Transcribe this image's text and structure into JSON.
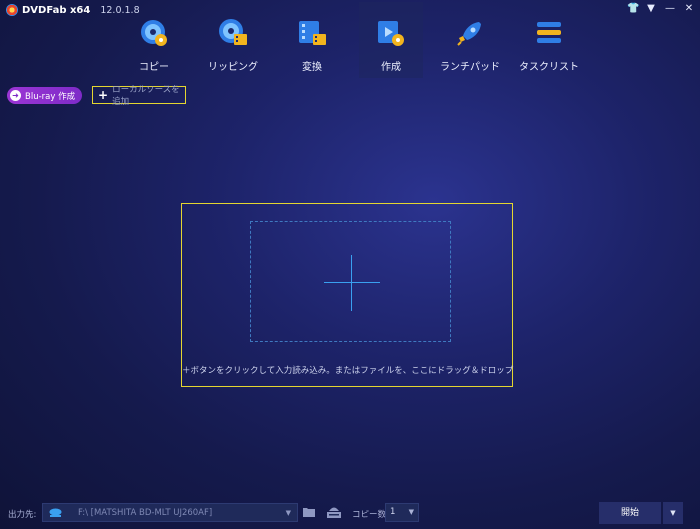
{
  "app": {
    "brand": "DVDFab x64",
    "version": "12.0.1.8"
  },
  "window_controls": [
    "shirt-icon",
    "dropdown-icon",
    "minimize-icon",
    "close-icon"
  ],
  "nav": {
    "tabs": [
      {
        "label": "コピー",
        "icon": "disc-copy-icon"
      },
      {
        "label": "リッピング",
        "icon": "disc-rip-icon"
      },
      {
        "label": "変換",
        "icon": "film-convert-icon"
      },
      {
        "label": "作成",
        "icon": "film-create-icon",
        "active": true
      },
      {
        "label": "ランチパッド",
        "icon": "rocket-icon"
      },
      {
        "label": "タスクリスト",
        "icon": "task-list-icon"
      }
    ]
  },
  "toolbar": {
    "mode_label": "Blu-ray 作成",
    "add_source_label": "ローカルソースを追加"
  },
  "drop_area": {
    "hint": "＋ボタンをクリックして入力読み込み。またはファイルを、ここにドラッグ＆ドロップ"
  },
  "bottom": {
    "output_label": "出力先:",
    "output_path": "F:\\ [MATSHITA BD-MLT UJ260AF]",
    "copies_label": "コピー数:",
    "copies_value": "1",
    "start_label": "開始"
  },
  "colors": {
    "accent_yellow": "#e4d630",
    "mode_purple": "#8a2fcd",
    "cross_blue": "#3aa0f0"
  }
}
